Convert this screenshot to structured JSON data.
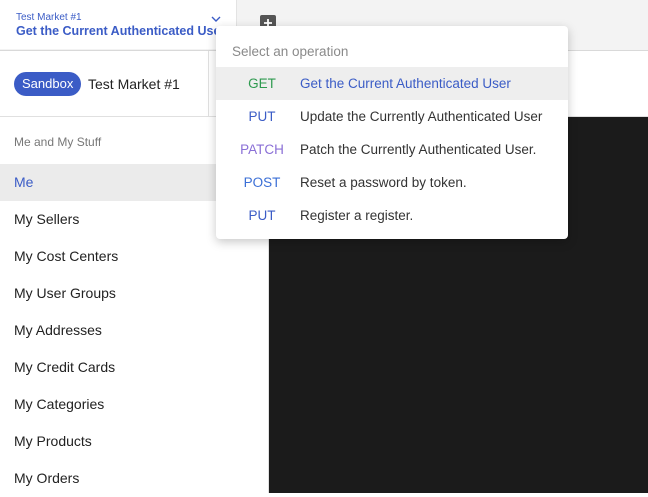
{
  "tab": {
    "subtitle": "Test Market #1",
    "title": "Get the Current Authenticated User"
  },
  "environment": {
    "badge": "Sandbox",
    "name": "Test Market #1"
  },
  "sidebar": {
    "heading": "Me and My Stuff",
    "items": [
      {
        "label": "Me",
        "active": true
      },
      {
        "label": "My Sellers"
      },
      {
        "label": "My Cost Centers"
      },
      {
        "label": "My User Groups"
      },
      {
        "label": "My Addresses"
      },
      {
        "label": "My Credit Cards"
      },
      {
        "label": "My Categories"
      },
      {
        "label": "My Products"
      },
      {
        "label": "My Orders"
      }
    ]
  },
  "dropdown": {
    "placeholder": "Select an operation",
    "operations": [
      {
        "method": "GET",
        "label": "Get the Current Authenticated User",
        "selected": true
      },
      {
        "method": "PUT",
        "label": "Update the Currently Authenticated User"
      },
      {
        "method": "PATCH",
        "label": "Patch the Currently Authenticated User."
      },
      {
        "method": "POST",
        "label": "Reset a password by token."
      },
      {
        "method": "PUT",
        "label": "Register a register."
      }
    ]
  },
  "colors": {
    "accent": "#3b5cc6",
    "GET": "#2e9a4f",
    "PUT": "#3b5cc6",
    "PATCH": "#8a6fd6",
    "POST": "#3b6fd6"
  },
  "icons": {
    "tab_dropdown": "chevron-down-icon",
    "add_tab": "plus-icon"
  }
}
